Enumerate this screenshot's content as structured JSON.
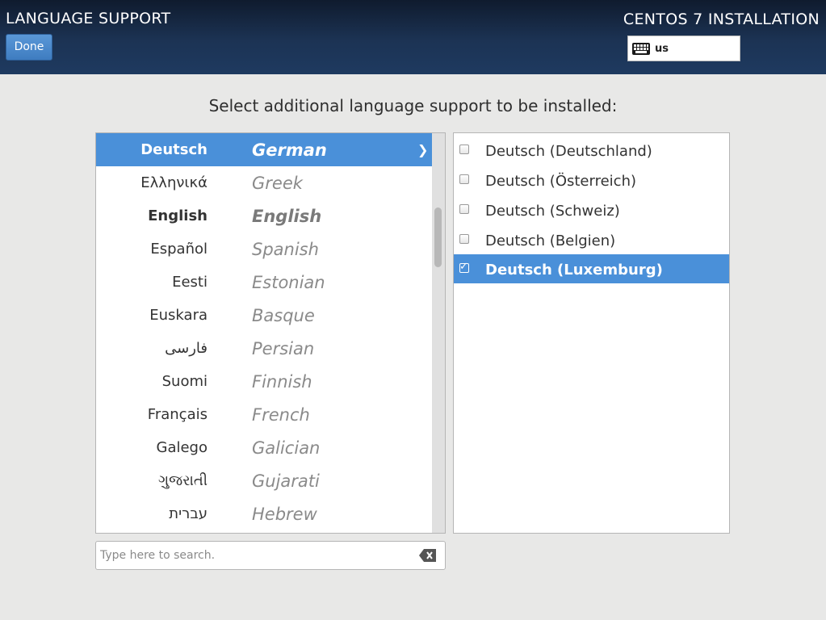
{
  "header": {
    "title": "LANGUAGE SUPPORT",
    "done_label": "Done",
    "product": "CENTOS 7 INSTALLATION",
    "keyboard_layout": "us"
  },
  "prompt": "Select additional language support to be installed:",
  "languages": [
    {
      "native": "Deutsch",
      "english": "German",
      "selected": true
    },
    {
      "native": "Ελληνικά",
      "english": "Greek"
    },
    {
      "native": "English",
      "english": "English",
      "emphasized": true
    },
    {
      "native": "Español",
      "english": "Spanish"
    },
    {
      "native": "Eesti",
      "english": "Estonian"
    },
    {
      "native": "Euskara",
      "english": "Basque"
    },
    {
      "native": "فارسی",
      "english": "Persian"
    },
    {
      "native": "Suomi",
      "english": "Finnish"
    },
    {
      "native": "Français",
      "english": "French"
    },
    {
      "native": "Galego",
      "english": "Galician"
    },
    {
      "native": "ગુજરાતી",
      "english": "Gujarati"
    },
    {
      "native": "עברית",
      "english": "Hebrew"
    }
  ],
  "locales": [
    {
      "label": "Deutsch (Deutschland)",
      "checked": false
    },
    {
      "label": "Deutsch (Österreich)",
      "checked": false
    },
    {
      "label": "Deutsch (Schweiz)",
      "checked": false
    },
    {
      "label": "Deutsch (Belgien)",
      "checked": false
    },
    {
      "label": "Deutsch (Luxemburg)",
      "checked": true,
      "selected": true
    }
  ],
  "search": {
    "placeholder": "Type here to search.",
    "value": ""
  },
  "colors": {
    "selection": "#4a90d9",
    "header_bg": "#1c3354"
  },
  "icons": {
    "keyboard": "keyboard-icon",
    "chevron": "chevron-right-icon",
    "clear": "clear-text-icon"
  }
}
